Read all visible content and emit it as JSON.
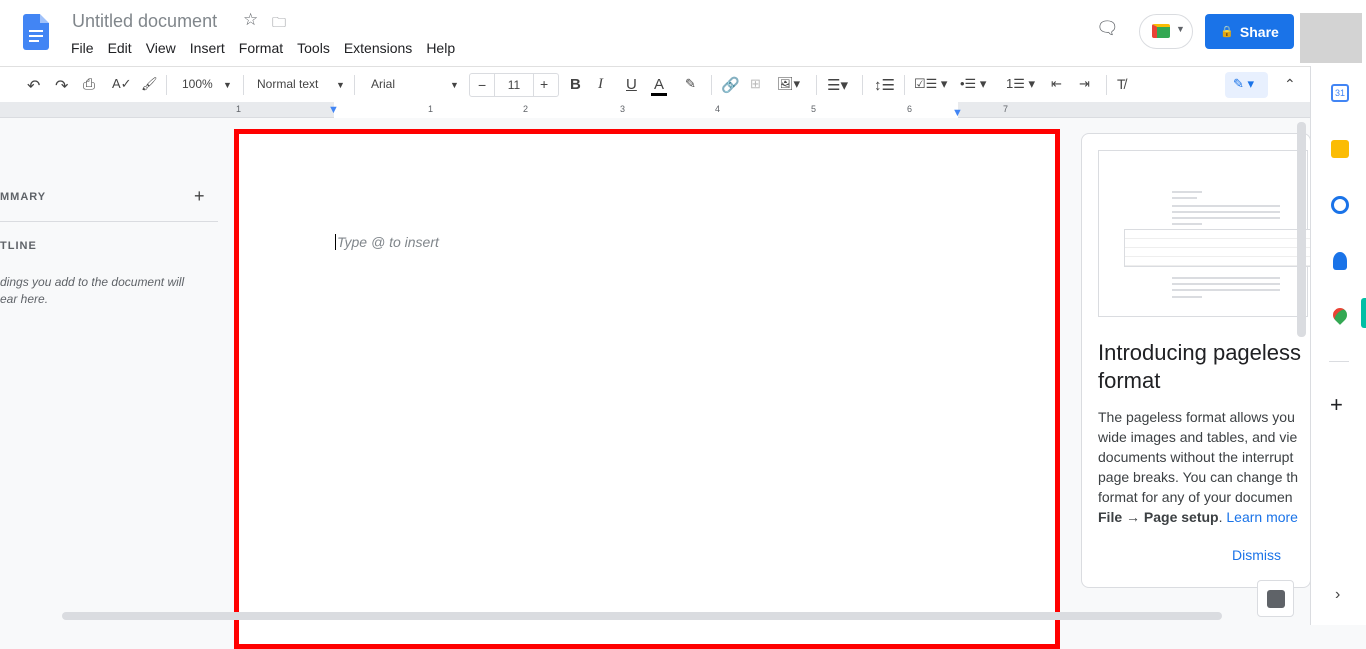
{
  "header": {
    "title": "Untitled document",
    "menu": [
      "File",
      "Edit",
      "View",
      "Insert",
      "Format",
      "Tools",
      "Extensions",
      "Help"
    ],
    "share_label": "Share"
  },
  "toolbar": {
    "zoom": "100%",
    "style": "Normal text",
    "font": "Arial",
    "font_size": "11"
  },
  "ruler": {
    "labels": [
      "1",
      "1",
      "2",
      "3",
      "4",
      "5",
      "6",
      "7"
    ]
  },
  "left_panel": {
    "summary": "MMARY",
    "outline": "TLINE",
    "hint_lines": [
      "dings you add to the document will",
      "ear here."
    ]
  },
  "document": {
    "placeholder": "Type @ to insert"
  },
  "card": {
    "title_lines": [
      "Introducing pageless",
      "format"
    ],
    "body_lines": [
      "The pageless format allows you",
      "wide images and tables, and vie",
      "documents without the interrupt",
      "page breaks. You can change th",
      "format for any of your documen"
    ],
    "bold_text": "File → Page setup",
    "link": "Learn more",
    "dismiss": "Dismiss"
  },
  "side_apps": [
    {
      "name": "calendar",
      "color": "#4285f4",
      "label": "31"
    },
    {
      "name": "keep",
      "color": "#fbbc04"
    },
    {
      "name": "tasks",
      "color": "#1a73e8"
    },
    {
      "name": "contacts",
      "color": "#1a73e8"
    },
    {
      "name": "maps",
      "color": "#34a853"
    }
  ],
  "colors": {
    "accent": "#1a73e8",
    "highlight": "#ff0000"
  }
}
